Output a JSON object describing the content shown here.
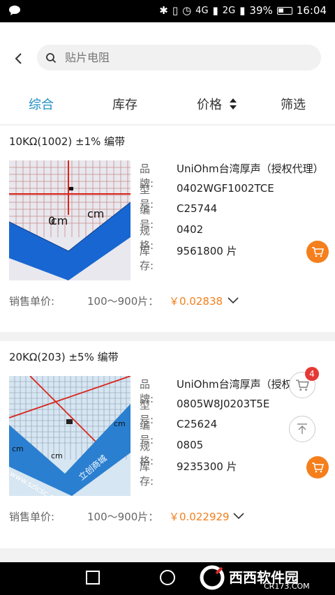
{
  "status_bar": {
    "time": "16:04",
    "battery_percent": "39%",
    "network_1": "4G",
    "network_2": "2G"
  },
  "search": {
    "placeholder": "贴片电阻"
  },
  "tabs": [
    {
      "label": "综合",
      "active": true
    },
    {
      "label": "库存",
      "active": false
    },
    {
      "label": "价格",
      "active": false
    },
    {
      "label": "筛选",
      "active": false
    }
  ],
  "products": [
    {
      "name": "10KΩ(1002) ±1% 编带",
      "attrs": [
        {
          "label": "品牌:",
          "value": "UniOhm台湾厚声（授权代理）"
        },
        {
          "label": "型号:",
          "value": "0402WGF1002TCE"
        },
        {
          "label": "编号:",
          "value": "C25744"
        },
        {
          "label": "规格:",
          "value": "0402"
        },
        {
          "label": "库存:",
          "value": "9561800 片"
        }
      ],
      "price_label": "销售单价:",
      "price_range": "100～900片：",
      "price": "￥0.02838"
    },
    {
      "name": "20KΩ(203) ±5% 编带",
      "attrs": [
        {
          "label": "品牌:",
          "value": "UniOhm台湾厚声（授权"
        },
        {
          "label": "型号:",
          "value": "0805W8J0203T5E"
        },
        {
          "label": "编号:",
          "value": "C25624"
        },
        {
          "label": "规格:",
          "value": "0805"
        },
        {
          "label": "库存:",
          "value": "9235300 片"
        }
      ],
      "price_label": "销售单价:",
      "price_range": "100～900片：",
      "price": "￥0.022929"
    }
  ],
  "cart_badge_count": "4",
  "thumb_text": {
    "cm": "cm",
    "zero": "0",
    "site": "www.szlcsc.com",
    "brand": "立创商城"
  },
  "watermark": {
    "text": "西西软件园",
    "sub": "CR173.COM"
  },
  "colors": {
    "accent": "#1d8ec2",
    "price": "#f47f1c",
    "cart": "#f47f1c",
    "badge": "#e53935"
  }
}
